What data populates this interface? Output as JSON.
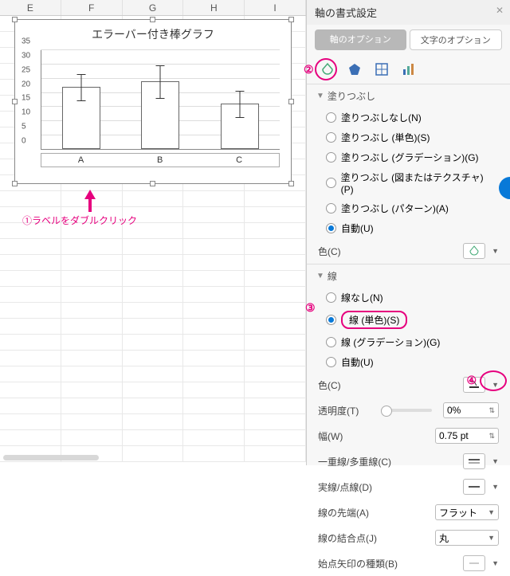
{
  "columns": [
    "E",
    "F",
    "G",
    "H",
    "I"
  ],
  "chart_data": {
    "type": "bar",
    "title": "エラーバー付き棒グラフ",
    "categories": [
      "A",
      "B",
      "C"
    ],
    "values": [
      22,
      24,
      16
    ],
    "errors": [
      5,
      6,
      5
    ],
    "ylim": [
      0,
      35
    ],
    "yticks": [
      0,
      5,
      10,
      15,
      20,
      25,
      30,
      35
    ],
    "xlabel": "",
    "ylabel": ""
  },
  "annotations": {
    "num1": "①",
    "label1": "ラベルをダブルクリック",
    "num2": "②",
    "num3": "③",
    "num4": "④"
  },
  "panel": {
    "title": "軸の書式設定",
    "tab_axis": "軸のオプション",
    "tab_text": "文字のオプション",
    "fill": {
      "header": "塗りつぶし",
      "none": "塗りつぶしなし(N)",
      "solid": "塗りつぶし (単色)(S)",
      "grad": "塗りつぶし (グラデーション)(G)",
      "pic": "塗りつぶし (図またはテクスチャ)(P)",
      "pattern": "塗りつぶし (パターン)(A)",
      "auto": "自動(U)",
      "color": "色(C)"
    },
    "line": {
      "header": "線",
      "none": "線なし(N)",
      "solid": "線 (単色)(S)",
      "grad": "線 (グラデーション)(G)",
      "auto": "自動(U)",
      "color": "色(C)",
      "trans": "透明度(T)",
      "trans_val": "0%",
      "width": "幅(W)",
      "width_val": "0.75 pt",
      "compound": "一重線/多重線(C)",
      "dash": "実線/点線(D)",
      "cap": "線の先端(A)",
      "cap_val": "フラット",
      "join": "線の結合点(J)",
      "join_val": "丸",
      "begin": "始点矢印の種類(B)"
    }
  }
}
